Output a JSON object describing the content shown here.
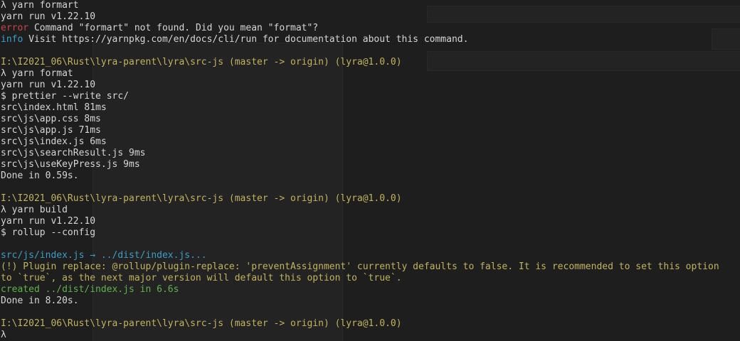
{
  "colors": {
    "background": "#1e1e1e",
    "text": "#d6d6d6",
    "error": "#c6454a",
    "info": "#3aa0cc",
    "prompt_path": "#c2b35e",
    "success": "#5fb34a",
    "bundle": "#3d9dc6"
  },
  "terminal": {
    "l01": "λ yarn formart",
    "l02": "yarn run v1.22.10",
    "l03_tag": "error",
    "l03_text": " Command \"formart\" not found. Did you mean \"format\"?",
    "l04_tag": "info",
    "l04_text": " Visit https://yarnpkg.com/en/docs/cli/run for documentation about this command.",
    "l05": "",
    "l06": "I:\\I2021_06\\Rust\\lyra-parent\\lyra\\src-js (master -> origin) (lyra@1.0.0)",
    "l07": "λ yarn format",
    "l08": "yarn run v1.22.10",
    "l09": "$ prettier --write src/",
    "l10": "src\\index.html 81ms",
    "l11": "src\\js\\app.css 8ms",
    "l12": "src\\js\\app.js 71ms",
    "l13": "src\\js\\index.js 6ms",
    "l14": "src\\js\\searchResult.js 9ms",
    "l15": "src\\js\\useKeyPress.js 9ms",
    "l16": "Done in 0.59s.",
    "l17": "",
    "l18": "I:\\I2021_06\\Rust\\lyra-parent\\lyra\\src-js (master -> origin) (lyra@1.0.0)",
    "l19": "λ yarn build",
    "l20": "yarn run v1.22.10",
    "l21": "$ rollup --config",
    "l22": "",
    "l23": "src/js/index.js → ../dist/index.js...",
    "l24": "(!) Plugin replace: @rollup/plugin-replace: 'preventAssignment' currently defaults to false. It is recommended to set this option",
    "l25": "to `true`, as the next major version will default this option to `true`.",
    "l26": "created ../dist/index.js in 6.6s",
    "l27": "Done in 8.20s.",
    "l28": "",
    "l29": "I:\\I2021_06\\Rust\\lyra-parent\\lyra\\src-js (master -> origin) (lyra@1.0.0)",
    "l30": "λ"
  }
}
